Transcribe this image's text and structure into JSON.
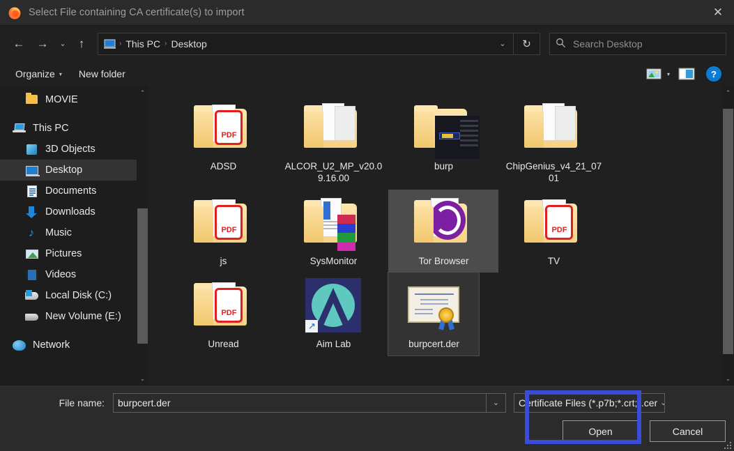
{
  "window": {
    "title": "Select File containing CA certificate(s) to import",
    "app_icon": "firefox-icon",
    "close_label": "✕"
  },
  "navbar": {
    "back_icon": "←",
    "forward_icon": "→",
    "recent_icon": "⌄",
    "up_icon": "↑",
    "path_icon": "desktop-icon",
    "breadcrumbs": [
      "This PC",
      "Desktop"
    ],
    "breadcrumb_sep": "›",
    "address_chevron": "⌄",
    "refresh_icon": "↻",
    "search_icon": "⌕",
    "search_placeholder": "Search Desktop",
    "search_value": ""
  },
  "commandbar": {
    "organize_label": "Organize",
    "organize_caret": "▾",
    "new_folder_label": "New folder",
    "view_icon": "view-large-icons-icon",
    "view_caret": "▾",
    "preview_pane_icon": "preview-pane-icon",
    "help_label": "?"
  },
  "sidebar": {
    "scroll_up": "⌃",
    "scroll_down": "⌄",
    "items": [
      {
        "label": "MOVIE",
        "icon": "folder-icon",
        "indent": 1,
        "selected": false
      },
      {
        "label": "This PC",
        "icon": "this-pc-icon",
        "indent": 0,
        "selected": false,
        "gap_before": true
      },
      {
        "label": "3D Objects",
        "icon": "3d-objects-icon",
        "indent": 1,
        "selected": false
      },
      {
        "label": "Desktop",
        "icon": "desktop-icon",
        "indent": 1,
        "selected": true
      },
      {
        "label": "Documents",
        "icon": "documents-icon",
        "indent": 1,
        "selected": false
      },
      {
        "label": "Downloads",
        "icon": "downloads-icon",
        "indent": 1,
        "selected": false
      },
      {
        "label": "Music",
        "icon": "music-icon",
        "indent": 1,
        "selected": false
      },
      {
        "label": "Pictures",
        "icon": "pictures-icon",
        "indent": 1,
        "selected": false
      },
      {
        "label": "Videos",
        "icon": "videos-icon",
        "indent": 1,
        "selected": false
      },
      {
        "label": "Local Disk (C:)",
        "icon": "local-disk-icon",
        "indent": 1,
        "selected": false
      },
      {
        "label": "New Volume (E:)",
        "icon": "drive-icon",
        "indent": 1,
        "selected": false
      },
      {
        "label": "Network",
        "icon": "network-icon",
        "indent": 0,
        "selected": false,
        "gap_before": true
      }
    ]
  },
  "files": [
    {
      "label": "ADSD",
      "icon": "folder-pdf-icon",
      "selected": false
    },
    {
      "label": "ALCOR_U2_MP_v20.09.16.00",
      "icon": "folder-docs-icon",
      "selected": false
    },
    {
      "label": "burp",
      "icon": "folder-screenshot-icon",
      "selected": false
    },
    {
      "label": "ChipGenius_v4_21_0701",
      "icon": "folder-docs-icon",
      "selected": false
    },
    {
      "label": "js",
      "icon": "folder-pdf-icon",
      "selected": false
    },
    {
      "label": "SysMonitor",
      "icon": "folder-mixed-icon",
      "selected": false
    },
    {
      "label": "Tor Browser",
      "icon": "folder-tor-icon",
      "selected": true
    },
    {
      "label": "TV",
      "icon": "folder-pdf-icon",
      "selected": false
    },
    {
      "label": "Unread",
      "icon": "folder-pdf-icon",
      "selected": false
    },
    {
      "label": "Aim Lab",
      "icon": "aim-lab-shortcut-icon",
      "selected": false
    },
    {
      "label": "burpcert.der",
      "icon": "certificate-icon",
      "selected": false,
      "focused": true
    }
  ],
  "footer": {
    "filename_label": "File name:",
    "filename_value": "burpcert.der",
    "filename_dropdown_icon": "⌄",
    "filter_value": "Certificate Files (*.p7b;*.crt;*.cer",
    "filter_chevron": "⌄",
    "open_label": "Open",
    "cancel_label": "Cancel"
  },
  "highlight": {
    "color": "#3b4cd8"
  },
  "scrollbars": {
    "up_arrow": "⌃",
    "down_arrow": "⌄"
  }
}
